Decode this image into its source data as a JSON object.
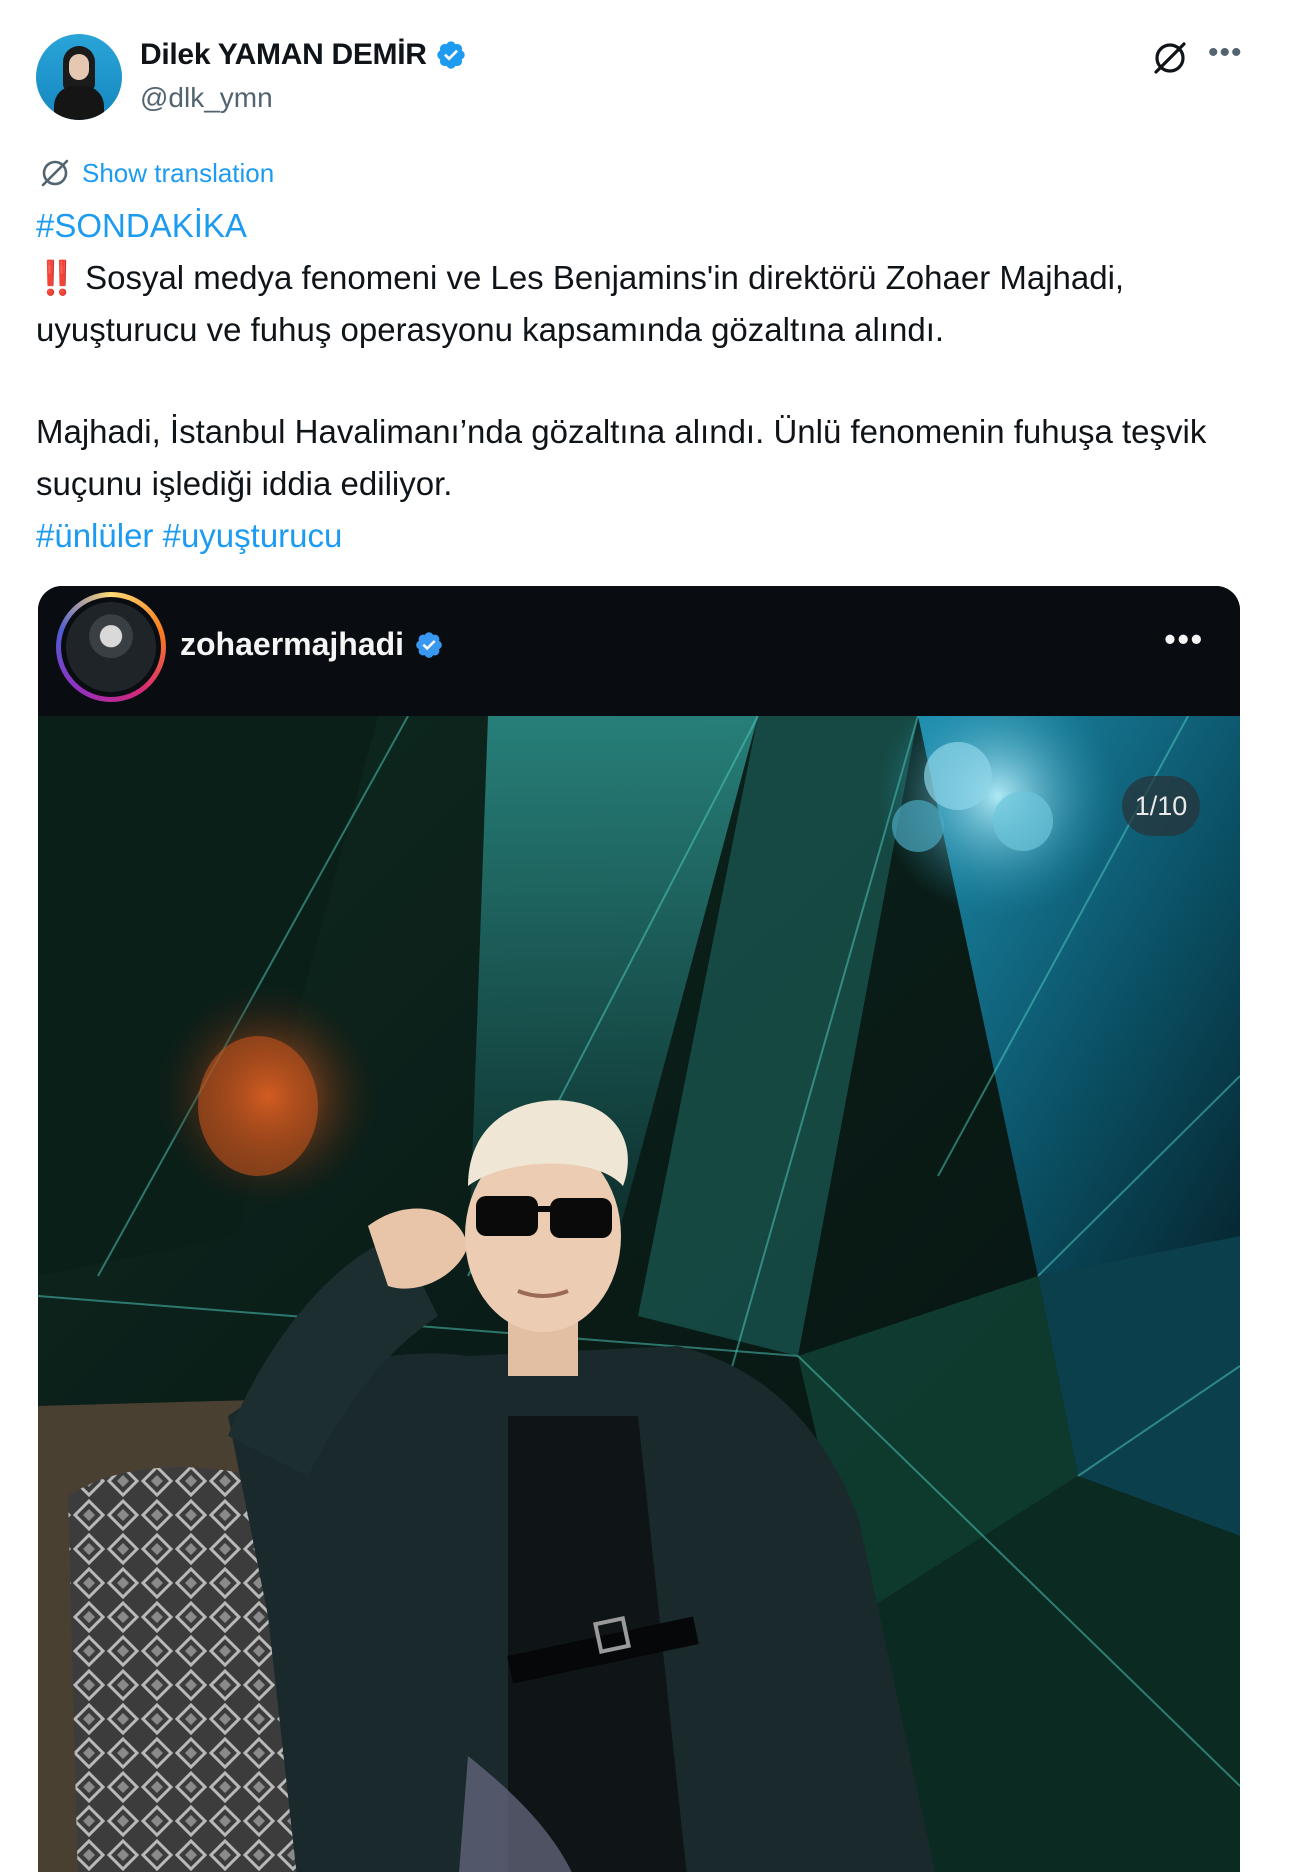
{
  "author": {
    "display_name": "Dilek YAMAN DEMİR",
    "handle": "@dlk_ymn",
    "verified": true,
    "avatar_icon": "profile-photo"
  },
  "header_icons": {
    "grok": "grok-icon",
    "more": "•••"
  },
  "translation": {
    "label": "Show translation"
  },
  "tweet": {
    "hashtag_top": "#SONDAKİKA",
    "emoji": "‼️",
    "paragraph1": "Sosyal medya fenomeni ve Les Benjamins'in direktörü Zohaer Majhadi, uyuşturucu ve fuhuş operasyonu kapsamında gözaltına alındı.",
    "paragraph2": "Majhadi, İstanbul Havalimanı’nda gözaltına alındı. Ünlü fenomenin fuhuşa teşvik suçunu işlediği iddia ediliyor.",
    "hashtags_bottom": "#ünlüler #uyuşturucu"
  },
  "embed": {
    "username": "zohaermajhadi",
    "verified": true,
    "more": "•••",
    "counter": "1/10"
  },
  "colors": {
    "link": "#1d9bf0",
    "text": "#0f1419",
    "secondary": "#536471",
    "verified": "#1d9bf0",
    "embed_bg": "#090d12"
  }
}
